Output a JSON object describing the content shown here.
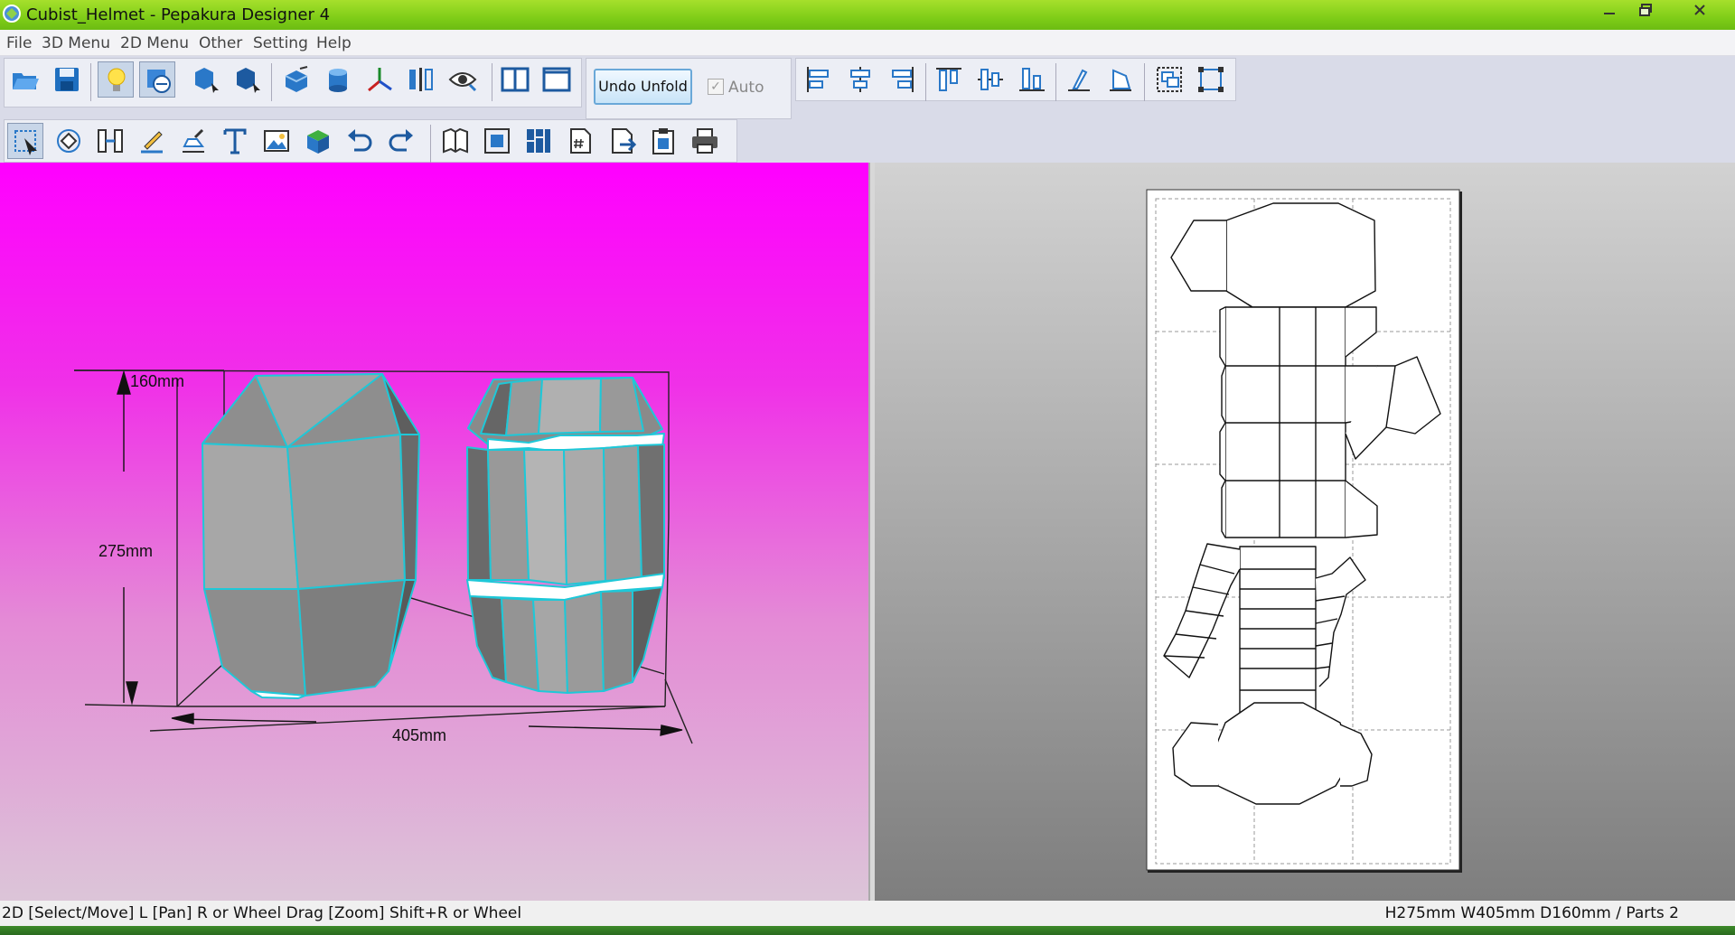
{
  "window": {
    "title": "Cubist_Helmet - Pepakura Designer 4"
  },
  "menu": [
    "File",
    "3D Menu",
    "2D Menu",
    "Other",
    "Setting",
    "Help"
  ],
  "toolbar": {
    "undo_unfold_label": "Undo Unfold",
    "auto_label": "Auto",
    "auto_checked": true
  },
  "view3d": {
    "dim_depth": "160mm",
    "dim_height": "275mm",
    "dim_width": "405mm",
    "background_top": "#ff00ff",
    "edge_color": "#1ec8d8"
  },
  "status": {
    "left": "2D [Select/Move] L [Pan] R or Wheel Drag [Zoom] Shift+R or Wheel",
    "right": "H275mm W405mm D160mm / Parts 2"
  },
  "icons": [
    "open-folder-icon",
    "save-icon",
    "lightbulb-icon",
    "texture-toggle-icon",
    "select-part-icon",
    "select-face-icon",
    "cube-icon",
    "cylinder-icon",
    "axis-icon",
    "mirror-icon",
    "eye-icon",
    "split-view-icon",
    "single-view-icon",
    "align-left-icon",
    "align-center-icon",
    "align-right-icon",
    "align-top-icon",
    "align-middle-icon",
    "align-bottom-icon",
    "rotate-left-icon",
    "rotate-right-icon",
    "group-icon",
    "ungroup-icon",
    "select-move-icon",
    "rotate-part-icon",
    "join-icon",
    "edit-line-icon",
    "fold-line-icon",
    "text-icon",
    "image-icon",
    "box-icon",
    "undo-icon",
    "redo-icon",
    "book-icon",
    "fit-icon",
    "grid-layout-icon",
    "page-number-icon",
    "export-icon",
    "clipboard-icon",
    "print-icon"
  ]
}
